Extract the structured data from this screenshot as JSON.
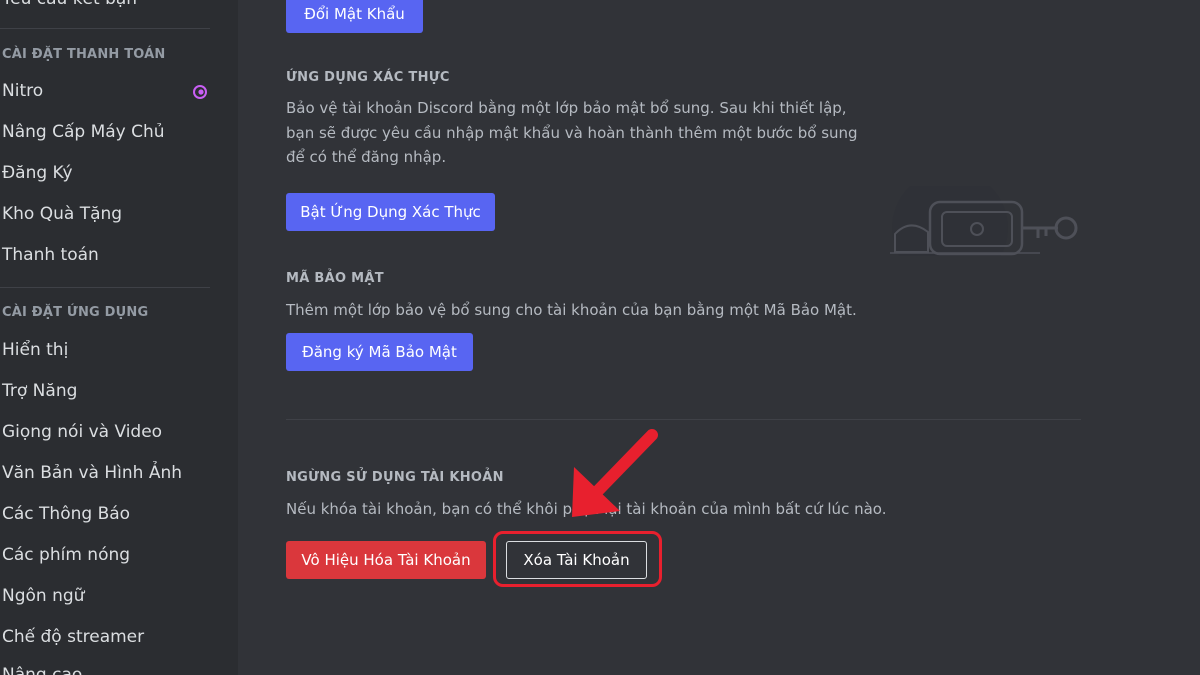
{
  "sidebar": {
    "cut_top_item": "Yêu cầu kết bạn",
    "billing_header": "CÀI ĐẶT THANH TOÁN",
    "billing_items": [
      "Nitro",
      "Nâng Cấp Máy Chủ",
      "Đăng Ký",
      "Kho Quà Tặng",
      "Thanh toán"
    ],
    "app_header": "CÀI ĐẶT ỨNG DỤNG",
    "app_items": [
      "Hiển thị",
      "Trợ Năng",
      "Giọng nói và Video",
      "Văn Bản và Hình Ảnh",
      "Các Thông Báo",
      "Các phím nóng",
      "Ngôn ngữ",
      "Chế độ streamer",
      "Nâng cao"
    ]
  },
  "main": {
    "change_password_button": "Đổi Mật Khẩu",
    "auth_app": {
      "title": "ỨNG DỤNG XÁC THỰC",
      "description": "Bảo vệ tài khoản Discord bằng một lớp bảo mật bổ sung. Sau khi thiết lập, bạn sẽ được yêu cầu nhập mật khẩu và hoàn thành thêm một bước bổ sung để có thể đăng nhập.",
      "button": "Bật Ứng Dụng Xác Thực"
    },
    "security_key": {
      "title": "MÃ BẢO MẬT",
      "description": "Thêm một lớp bảo vệ bổ sung cho tài khoản của bạn bằng một Mã Bảo Mật.",
      "button": "Đăng ký Mã Bảo Mật"
    },
    "account_removal": {
      "title": "NGỪNG SỬ DỤNG TÀI KHOẢN",
      "description": "Nếu khóa tài khoản, bạn có thể khôi phục lại tài khoản của mình bất cứ lúc nào.",
      "disable_button": "Vô Hiệu Hóa Tài Khoản",
      "delete_button": "Xóa Tài Khoản"
    }
  },
  "colors": {
    "accent_blue": "#5865f2",
    "danger_red": "#da373c",
    "annotation_red": "#e8202e"
  }
}
